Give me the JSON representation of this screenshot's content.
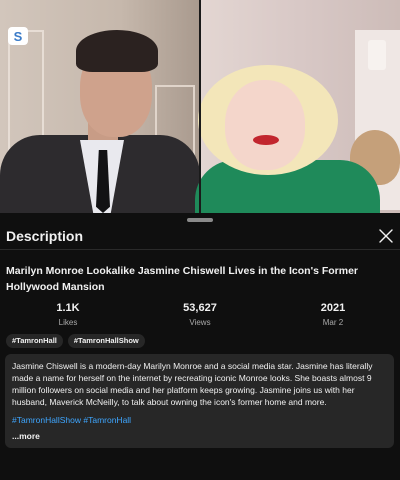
{
  "video": {
    "channel_logo_text": "S"
  },
  "sheet": {
    "title": "Description"
  },
  "video_title": "Marilyn Monroe Lookalike Jasmine Chiswell Lives in the Icon's Former Hollywood Mansion",
  "stats": {
    "likes": {
      "value": "1.1K",
      "label": "Likes"
    },
    "views": {
      "value": "53,627",
      "label": "Views"
    },
    "date": {
      "value": "2021",
      "label": "Mar 2"
    }
  },
  "chips": [
    "#TamronHall",
    "#TamronHallShow"
  ],
  "description": {
    "text": "Jasmine Chiswell is a modern-day Marilyn Monroe and a social media star. Jasmine has literally made a name for herself on the internet by recreating iconic Monroe looks. She boasts almost 9 million followers on social media and her platform keeps growing. Jasmine joins us with her husband, Maverick McNeilly, to talk about owning the icon's former home and more.",
    "hashtags": [
      "#TamronHallShow",
      "#TamronHall"
    ],
    "more_label": "...more"
  },
  "colors": {
    "background": "#0f0f0f",
    "surface": "#272727",
    "link": "#3ea6ff"
  }
}
